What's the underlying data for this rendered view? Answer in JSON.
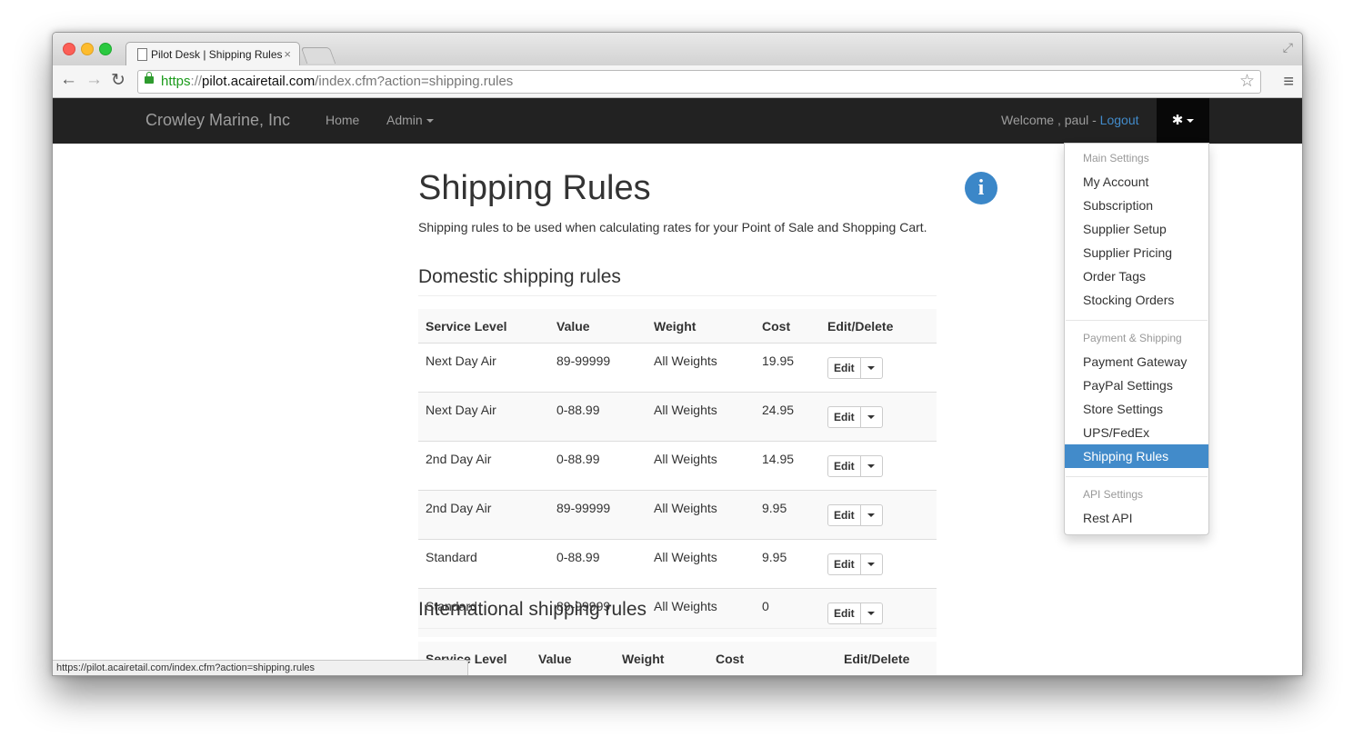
{
  "browser": {
    "tab_title": "Pilot Desk | Shipping Rules",
    "url_scheme": "https",
    "url_separator": "://",
    "url_host": "pilot.acairetail.com",
    "url_path": "/index.cfm?action=shipping.rules",
    "status_url": "https://pilot.acairetail.com/index.cfm?action=shipping.rules"
  },
  "navbar": {
    "brand": "Crowley Marine, Inc",
    "home": "Home",
    "admin": "Admin",
    "welcome": "Welcome , paul - ",
    "logout": "Logout",
    "settings_icon": "gear-icon"
  },
  "page": {
    "title": "Shipping Rules",
    "description": "Shipping rules to be used when calculating rates for your Point of Sale and Shopping Cart.",
    "info_icon": "info-icon"
  },
  "domestic": {
    "title": "Domestic shipping rules",
    "headers": [
      "Service Level",
      "Value",
      "Weight",
      "Cost",
      "Edit/Delete"
    ],
    "rows": [
      {
        "service": "Next Day Air",
        "value": "89-99999",
        "weight": "All Weights",
        "cost": "19.95"
      },
      {
        "service": "Next Day Air",
        "value": "0-88.99",
        "weight": "All Weights",
        "cost": "24.95"
      },
      {
        "service": "2nd Day Air",
        "value": "0-88.99",
        "weight": "All Weights",
        "cost": "14.95"
      },
      {
        "service": "2nd Day Air",
        "value": "89-99999",
        "weight": "All Weights",
        "cost": "9.95"
      },
      {
        "service": "Standard",
        "value": "0-88.99",
        "weight": "All Weights",
        "cost": "9.95"
      },
      {
        "service": "Standard",
        "value": "89-99999",
        "weight": "All Weights",
        "cost": "0"
      }
    ],
    "edit_label": "Edit"
  },
  "international": {
    "title": "International shipping rules",
    "headers": [
      "Service Level",
      "Value",
      "Weight",
      "Cost",
      "Edit/Delete"
    ]
  },
  "dropdown": {
    "main_header": "Main Settings",
    "my_account": "My Account",
    "subscription": "Subscription",
    "supplier_setup": "Supplier Setup",
    "supplier_pricing": "Supplier Pricing",
    "order_tags": "Order Tags",
    "stocking_orders": "Stocking Orders",
    "payment_header": "Payment & Shipping",
    "payment_gateway": "Payment Gateway",
    "paypal_settings": "PayPal Settings",
    "store_settings": "Store Settings",
    "ups_fedex": "UPS/FedEx",
    "shipping_rules": "Shipping Rules",
    "api_header": "API Settings",
    "rest_api": "Rest API"
  },
  "colors": {
    "navbar_bg": "#222222",
    "link": "#428bca",
    "active_item": "#428bca",
    "info_icon": "#3b87c8"
  }
}
